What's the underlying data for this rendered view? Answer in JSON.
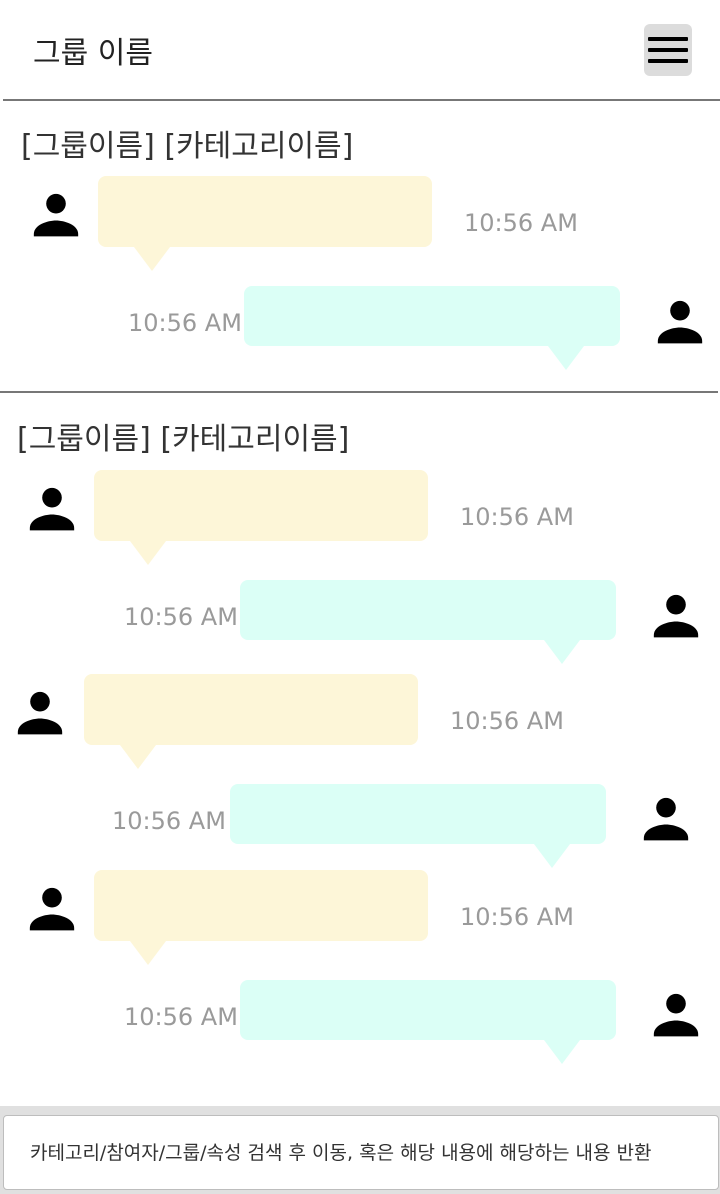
{
  "header": {
    "title": "그룹 이름",
    "menu_icon": "hamburger-menu-icon"
  },
  "sections": [
    {
      "title": "[그룹이름] [카테고리이름]",
      "messages": [
        {
          "side": "left",
          "time": "10:56 AM"
        },
        {
          "side": "right",
          "time": "10:56 AM"
        }
      ]
    },
    {
      "title": "[그룹이름] [카테고리이름]",
      "messages": [
        {
          "side": "left",
          "time": "10:56 AM"
        },
        {
          "side": "right",
          "time": "10:56 AM"
        },
        {
          "side": "left",
          "time": "10:56 AM"
        },
        {
          "side": "right",
          "time": "10:56 AM"
        },
        {
          "side": "left",
          "time": "10:56 AM"
        },
        {
          "side": "right",
          "time": "10:56 AM"
        }
      ]
    }
  ],
  "search": {
    "placeholder": "카테고리/참여자/그룹/속성 검색 후 이동, 혹은 해당 내용에 해당하는 내용 반환"
  },
  "colors": {
    "left_bubble": "#fdf6d8",
    "right_bubble": "#dbfff6",
    "timestamp": "#9a9a9a"
  },
  "icons": {
    "avatar": "user-avatar-icon"
  }
}
